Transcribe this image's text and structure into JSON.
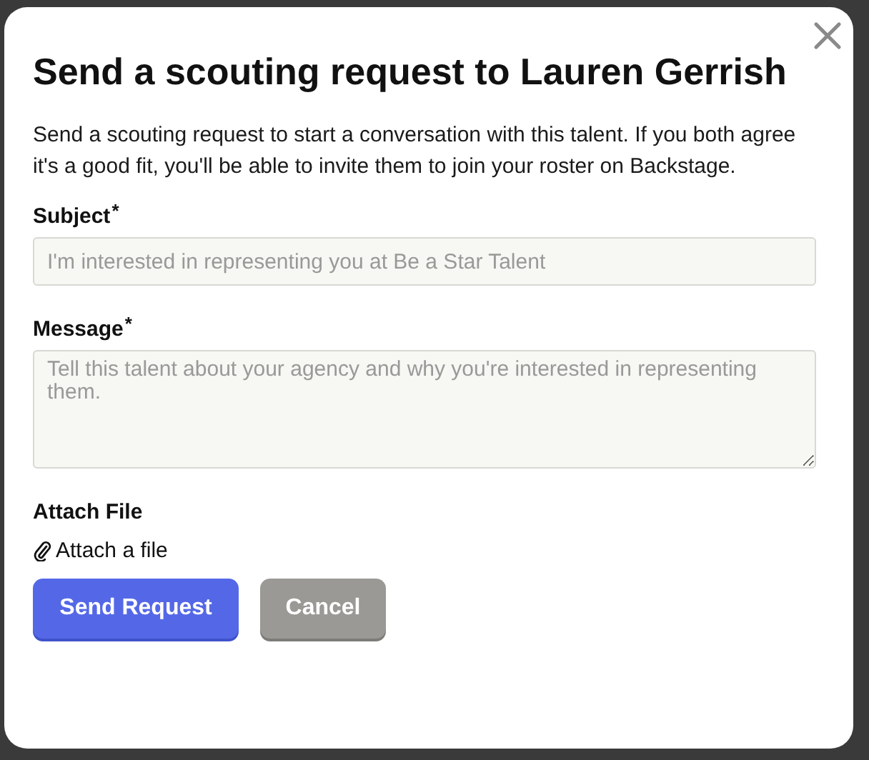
{
  "dialog": {
    "title": "Send a scouting request to Lauren Gerrish",
    "description": "Send a scouting request to start a conversation with this talent. If you both agree it's a good fit, you'll be able to invite them to join your roster on Backstage.",
    "fields": [
      {
        "label": "Subject",
        "required": "*",
        "kind": "input",
        "placeholder": "I'm interested in representing you at Be a Star Talent"
      },
      {
        "label": "Message",
        "required": "*",
        "kind": "textarea",
        "placeholder": "Tell this talent about your agency and why you're interested in representing them."
      }
    ],
    "attachment": {
      "label": "Attach File",
      "link": "Attach a file"
    },
    "buttons": [
      {
        "label": "Send Request",
        "kind": "primary"
      },
      {
        "label": "Cancel",
        "kind": "secondary"
      }
    ]
  }
}
